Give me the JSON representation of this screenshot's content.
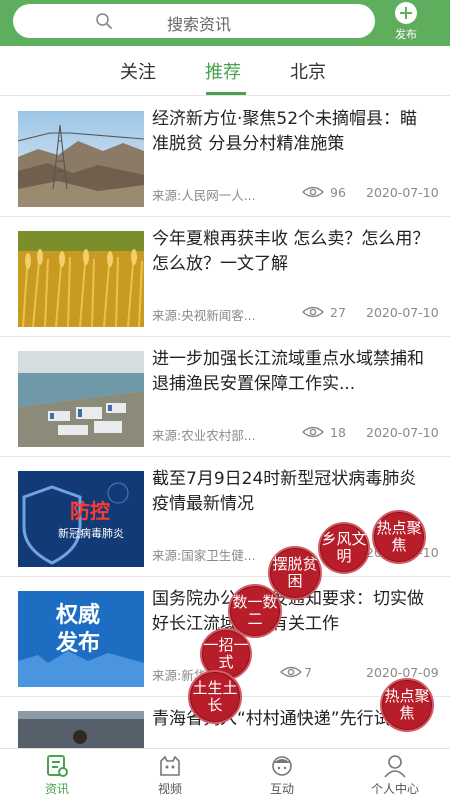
{
  "header": {
    "search_placeholder": "搜索资讯",
    "publish_label": "发布"
  },
  "tabs": [
    {
      "label": "关注"
    },
    {
      "label": "推荐",
      "active": true
    },
    {
      "label": "北京"
    }
  ],
  "articles": [
    {
      "title": "经济新方位·聚焦52个未摘帽县：瞄准脱贫 分县分村精准施策",
      "source": "来源:人民网一人...",
      "views": "96",
      "date": "2020-07-10",
      "thumb": "mountain-power-tower"
    },
    {
      "title": "今年夏粮再获丰收 怎么卖？怎么用？怎么放？一文了解",
      "source": "来源:央视新闻客...",
      "views": "27",
      "date": "2020-07-10",
      "thumb": "wheat-field"
    },
    {
      "title": "进一步加强长江流域重点水域禁捕和退捕渔民安置保障工作实...",
      "source": "来源:农业农村部...",
      "views": "18",
      "date": "2020-07-10",
      "thumb": "river-town-aerial"
    },
    {
      "title": "截至7月9日24时新型冠状病毒肺炎疫情最新情况",
      "source": "来源:国家卫生健...",
      "views": "",
      "date": "2020-07-10",
      "thumb": "epidemic-shield",
      "thumb_text": [
        "防控",
        "新冠病毒肺炎"
      ]
    },
    {
      "title": "国务院办公厅印发通知要求：切实做好长江流域禁捕有关工作",
      "source": "来源:新华...",
      "views": "7",
      "date": "2020-07-09",
      "thumb": "authority-release",
      "thumb_text": [
        "权威",
        "发布"
      ]
    },
    {
      "title": "青海省列入“村村通快递”先行试点",
      "source": "",
      "views": "",
      "date": "",
      "thumb": "village"
    }
  ],
  "seals": [
    "热点聚焦",
    "乡风文明",
    "摆脱贫困",
    "数一数二",
    "一招一式",
    "土生土长",
    "热点聚焦"
  ],
  "bottom_nav": [
    {
      "label": "资讯",
      "icon": "news-icon",
      "active": true
    },
    {
      "label": "视频",
      "icon": "video-icon"
    },
    {
      "label": "互动",
      "icon": "interact-icon"
    },
    {
      "label": "个人中心",
      "icon": "profile-icon"
    }
  ],
  "colors": {
    "brand_green": "#5fae5e",
    "active_green": "#4aa14b",
    "seal_red": "#b81e2a"
  }
}
